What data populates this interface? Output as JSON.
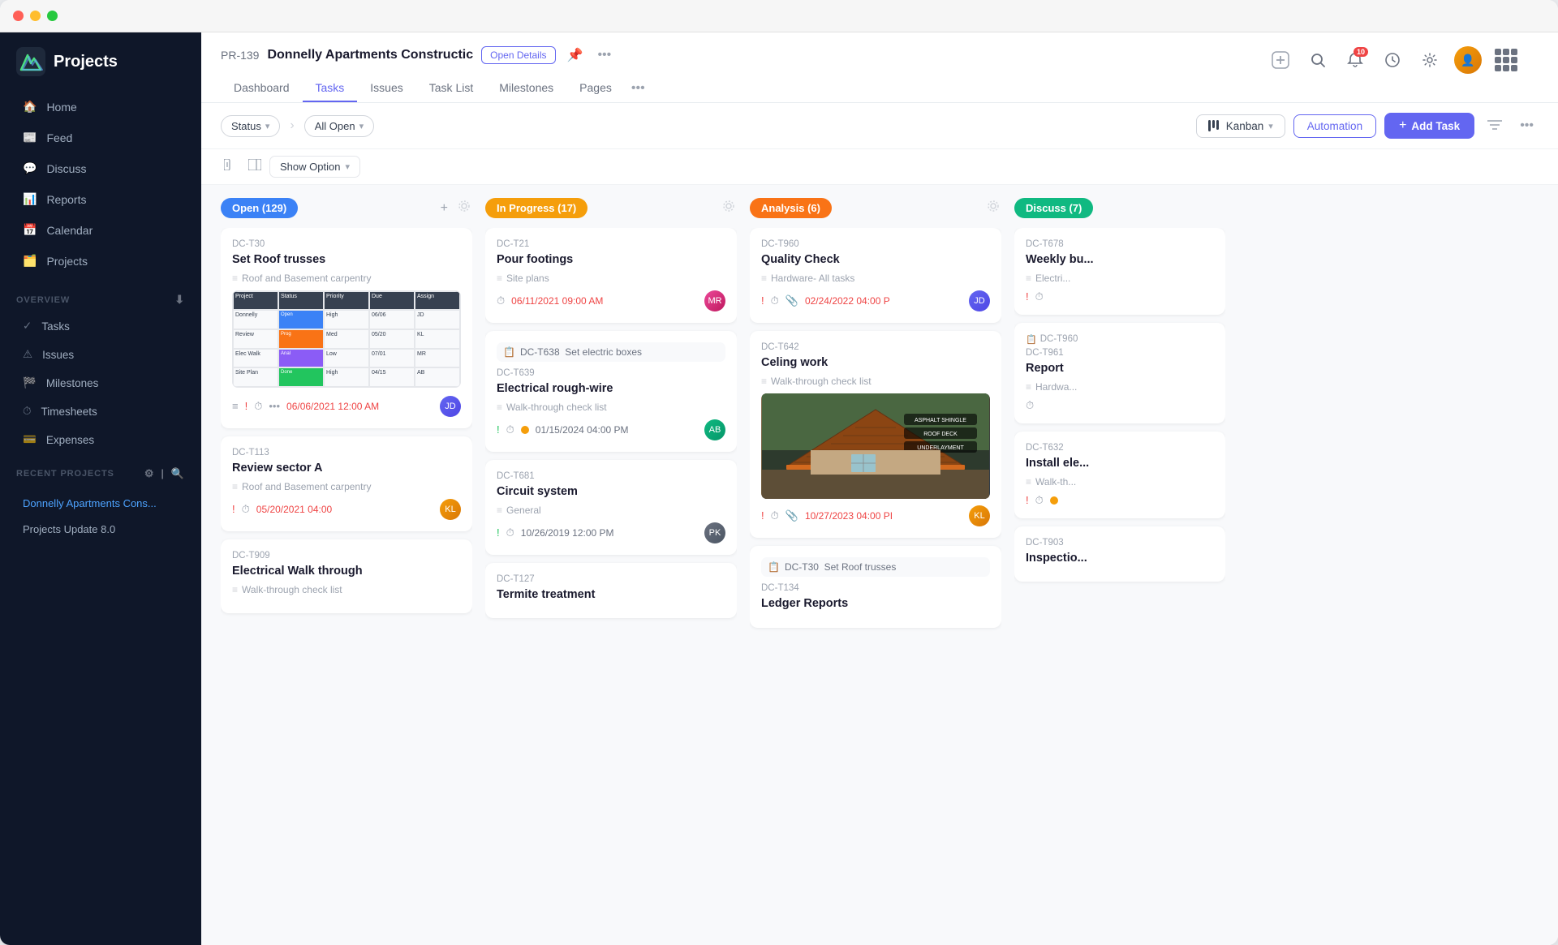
{
  "window": {
    "title": "Projects"
  },
  "titlebar": {
    "buttons": [
      "red",
      "yellow",
      "green"
    ]
  },
  "sidebar": {
    "logo_text": "Projects",
    "nav_items": [
      {
        "id": "home",
        "label": "Home",
        "icon": "home"
      },
      {
        "id": "feed",
        "label": "Feed",
        "icon": "feed"
      },
      {
        "id": "discuss",
        "label": "Discuss",
        "icon": "discuss"
      },
      {
        "id": "reports",
        "label": "Reports",
        "icon": "reports"
      },
      {
        "id": "calendar",
        "label": "Calendar",
        "icon": "calendar"
      },
      {
        "id": "projects",
        "label": "Projects",
        "icon": "projects"
      }
    ],
    "overview_label": "Overview",
    "overview_items": [
      {
        "label": "Tasks"
      },
      {
        "label": "Issues"
      },
      {
        "label": "Milestones"
      },
      {
        "label": "Timesheets"
      },
      {
        "label": "Expenses"
      }
    ],
    "recent_projects_label": "Recent Projects",
    "recent_projects": [
      {
        "label": "Donnelly Apartments Cons...",
        "active": true
      },
      {
        "label": "Projects Update 8.0",
        "active": false
      }
    ]
  },
  "header": {
    "project_id": "PR-139",
    "project_name": "Donnelly Apartments Constructic",
    "open_details_btn": "Open Details",
    "tabs": [
      {
        "label": "Dashboard",
        "active": false
      },
      {
        "label": "Tasks",
        "active": true
      },
      {
        "label": "Issues",
        "active": false
      },
      {
        "label": "Task List",
        "active": false
      },
      {
        "label": "Milestones",
        "active": false
      },
      {
        "label": "Pages",
        "active": false
      }
    ],
    "notification_count": "10"
  },
  "toolbar": {
    "status_label": "Status",
    "all_open_label": "All Open",
    "kanban_label": "Kanban",
    "automation_label": "Automation",
    "add_task_label": "Add Task",
    "show_option_label": "Show Option"
  },
  "kanban": {
    "columns": [
      {
        "id": "open",
        "label": "Open (129)",
        "color": "open",
        "cards": [
          {
            "id": "DC-T30",
            "title": "Set Roof trusses",
            "subtitle": "Roof and Basement carpentry",
            "has_image": true,
            "image_type": "spreadsheet",
            "date": "06/06/2021 12:00 AM",
            "date_color": "red",
            "has_avatar": true,
            "icons": [
              "priority",
              "clock",
              "more"
            ]
          },
          {
            "id": "DC-T113",
            "title": "Review sector A",
            "subtitle": "Roof and Basement carpentry",
            "date": "05/20/2021 04:00",
            "date_color": "red",
            "has_avatar": true,
            "icons": [
              "priority",
              "clock"
            ]
          },
          {
            "id": "DC-T909",
            "title": "Electrical Walk through",
            "subtitle": "Walk-through check list",
            "date": "",
            "has_avatar": false,
            "icons": []
          }
        ]
      },
      {
        "id": "inprogress",
        "label": "In Progress (17)",
        "color": "inprogress",
        "cards": [
          {
            "id": "DC-T21",
            "title": "Pour footings",
            "subtitle": "Site plans",
            "date": "06/11/2021 09:00 AM",
            "date_color": "red",
            "has_avatar": true,
            "icons": [
              "clock"
            ]
          },
          {
            "id": "DC-T638",
            "subgroup": "DC-T638  Set electric boxes",
            "sub_id": "DC-T639",
            "title": "Electrical rough-wire",
            "subtitle": "Walk-through check list",
            "date": "01/15/2024 04:00 PM",
            "date_color": "normal",
            "has_avatar": true,
            "icons": [
              "priority-green",
              "clock",
              "dot-yellow"
            ]
          },
          {
            "id": "DC-T681",
            "title": "Circuit system",
            "subtitle": "General",
            "date": "10/26/2019 12:00 PM",
            "date_color": "normal",
            "has_avatar": true,
            "icons": [
              "priority-green",
              "clock"
            ]
          },
          {
            "id": "DC-T127",
            "title": "Termite treatment",
            "subtitle": "",
            "date": "",
            "has_avatar": false,
            "icons": []
          }
        ]
      },
      {
        "id": "analysis",
        "label": "Analysis (6)",
        "color": "analysis",
        "cards": [
          {
            "id": "DC-T960",
            "title": "Quality Check",
            "subtitle": "Hardware- All tasks",
            "date": "02/24/2022 04:00 P",
            "date_color": "red",
            "has_avatar": true,
            "icons": [
              "priority",
              "clock",
              "attach"
            ]
          },
          {
            "id": "DC-T642",
            "title": "Celing work",
            "subtitle": "Walk-through check list",
            "has_image": true,
            "image_type": "roofing",
            "date": "10/27/2023 04:00 PI",
            "date_color": "red",
            "has_avatar": true,
            "icons": [
              "priority",
              "clock",
              "attach"
            ]
          },
          {
            "id": "DC-T30",
            "subgroup": "DC-T30  Set Roof trusses",
            "sub_id": "DC-T134",
            "title": "Ledger Reports",
            "subtitle": "",
            "date": "",
            "has_avatar": false,
            "icons": []
          }
        ]
      },
      {
        "id": "discuss",
        "label": "Discuss (7)",
        "color": "discuss",
        "cards": [
          {
            "id": "DC-T678",
            "title": "Weekly bu...",
            "subtitle": "Electri...",
            "date": "",
            "has_avatar": false,
            "icons": [
              "priority",
              "clock"
            ]
          },
          {
            "id": "DC-T960",
            "sub_id": "DC-T961",
            "title": "Report",
            "subtitle": "Hardwa...",
            "date": "",
            "has_avatar": false,
            "icons": [
              "clock"
            ]
          },
          {
            "id": "DC-T632",
            "title": "Install ele...",
            "subtitle": "Walk-th...",
            "date": "",
            "has_avatar": false,
            "icons": [
              "priority",
              "clock",
              "dot-yellow"
            ]
          },
          {
            "id": "DC-T903",
            "title": "Inspectio...",
            "subtitle": "",
            "date": "",
            "has_avatar": false,
            "icons": []
          }
        ]
      }
    ]
  }
}
